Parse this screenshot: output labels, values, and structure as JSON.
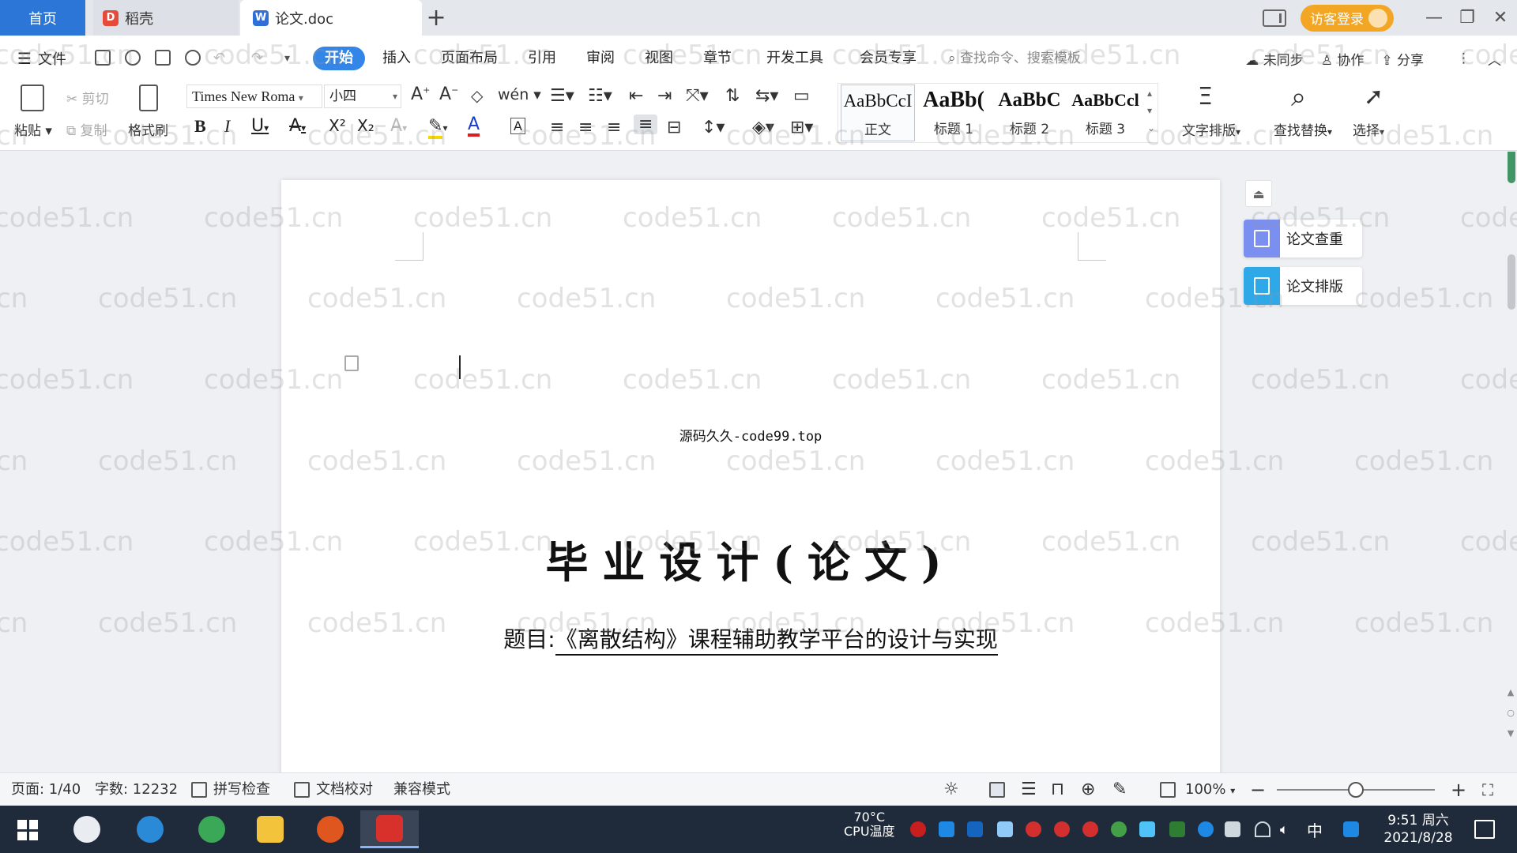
{
  "tabs": {
    "home": "首页",
    "daoke": "稻壳",
    "doc": "论文.doc",
    "add": "+"
  },
  "titlebar": {
    "login": "访客登录",
    "minimize": "—",
    "restore": "❐",
    "close": "✕"
  },
  "menu": {
    "file": "文件",
    "items": [
      "开始",
      "插入",
      "页面布局",
      "引用",
      "审阅",
      "视图",
      "章节",
      "开发工具",
      "会员专享"
    ],
    "search_placeholder": "查找命令、搜索模板",
    "unsynced": "未同步",
    "collab": "协作",
    "share": "分享"
  },
  "ribbon": {
    "paste": "粘贴",
    "cut": "剪切",
    "copy": "复制",
    "format_painter": "格式刷",
    "font_name": "Times New Roma",
    "font_size": "小四",
    "styles": [
      {
        "preview": "AaBbCcI",
        "label": "正文"
      },
      {
        "preview": "AaBb(",
        "label": "标题 1"
      },
      {
        "preview": "AaBbC",
        "label": "标题 2"
      },
      {
        "preview": "AaBbCcl",
        "label": "标题 3"
      }
    ],
    "text_layout": "文字排版",
    "find_replace": "查找替换",
    "select": "选择",
    "bold": "B",
    "italic": "I",
    "underline": "U",
    "superscript": "X²",
    "subscript": "X₂",
    "font_color": "A",
    "char_border": "A",
    "strike": "A"
  },
  "document": {
    "source_line": "源码久久-code99.top",
    "title": "毕业设计(论文)",
    "topic_label": "题目:",
    "topic_value": "《离散结构》课程辅助教学平台的设计与实现"
  },
  "side_panel": {
    "check": "论文查重",
    "format": "论文排版"
  },
  "status": {
    "page": "页面: 1/40",
    "words": "字数: 12232",
    "spell": "拼写检查",
    "proofread": "文档校对",
    "compat": "兼容模式",
    "zoom": "100%",
    "zoom_out": "−",
    "zoom_in": "+"
  },
  "taskbar": {
    "cpu_temp": "70°C",
    "cpu_label": "CPU温度",
    "ime": "中",
    "time": "9:51 周六",
    "date": "2021/8/28"
  },
  "watermark": "code51.cn",
  "colors": {
    "accent": "#3386e8",
    "home_tab": "#2b76d6",
    "login": "#f3a623",
    "side_check": "#7b8ff0",
    "side_format": "#2fa8e8"
  }
}
